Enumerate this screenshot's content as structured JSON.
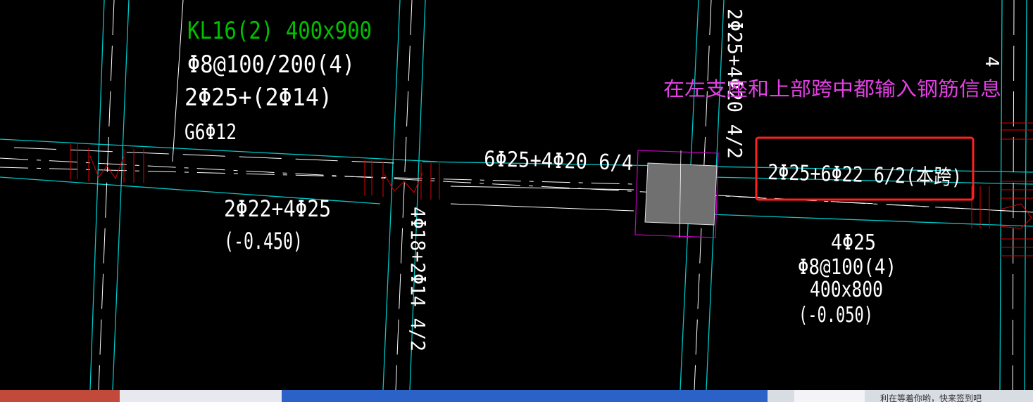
{
  "beam_mark": "KL16(2) 400x900",
  "stirrup": "Φ8@100/200(4)",
  "top_rebar": "2Φ25+(2Φ14)",
  "side_rebar": "G6Φ12",
  "left_span_bottom": "2Φ22+4Φ25",
  "left_span_elev": "(-0.450)",
  "support_top": "6Φ25+4Φ20 6/4",
  "right_top": "2Φ25+6Φ22 6/2(本跨)",
  "right_beam": {
    "rebar": "4Φ25",
    "stirrup": "Φ8@100(4)",
    "size": "400x800",
    "elev": "(-0.050)"
  },
  "vertical_mid": "4Φ18+2Φ14 4/2",
  "vertical_col_top": "2Φ25+4Φ20 4/2",
  "vertical_edge": "4",
  "annotation": "在左支座和上部跨中都输入钢筋信息",
  "taskbar_hint": "利在等着你哟，快来签到吧",
  "colors": {
    "background": "#000000",
    "axis": "#00c8c8",
    "beam_line": "#ffffff",
    "beam_mark": "#00c000",
    "rebar_red": "#e00000",
    "annotation": "#e040e0",
    "highlight_box": "#ff2020",
    "column_fill": "#707070",
    "column_outline": "#c000c0"
  }
}
